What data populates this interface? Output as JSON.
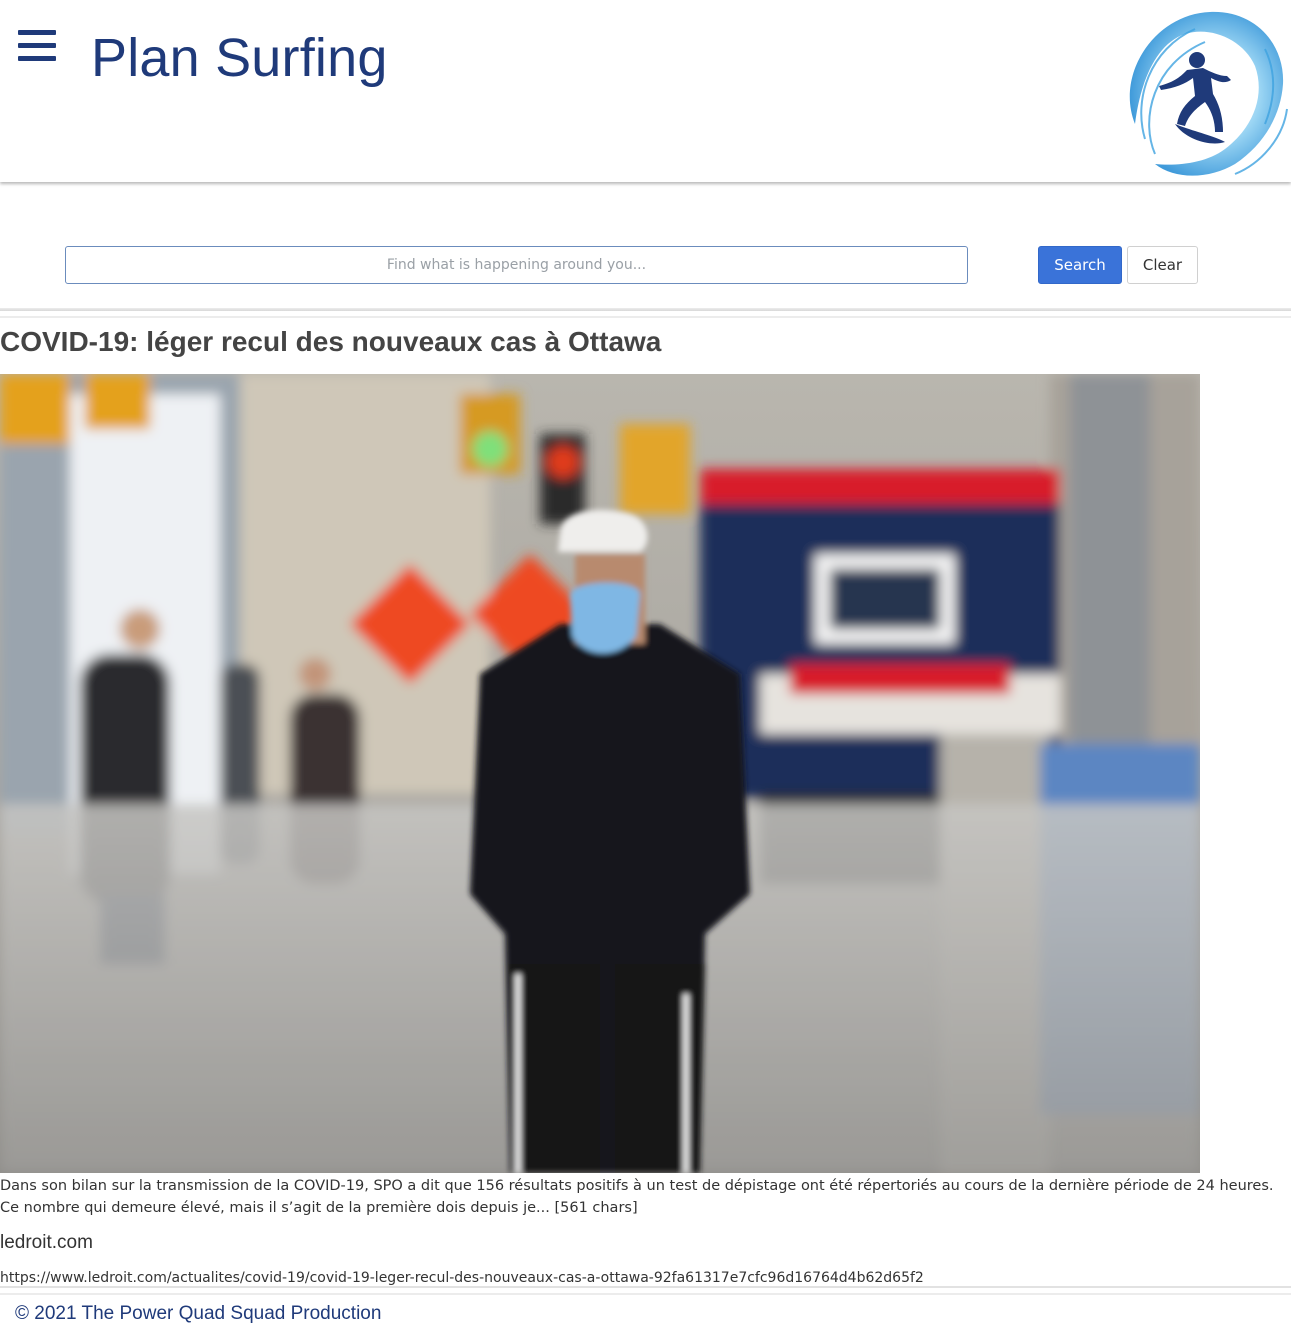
{
  "header": {
    "title": "Plan Surfing",
    "menu_icon": "hamburger-menu-icon",
    "logo": "surfer-wave-logo"
  },
  "search": {
    "placeholder": "Find what is happening around you...",
    "value": "",
    "search_label": "Search",
    "clear_label": "Clear"
  },
  "article": {
    "title": "COVID-19: léger recul des nouveaux cas à Ottawa",
    "image": "photo-masked-man-walking-ottawa-street",
    "description": "Dans son bilan sur la transmission de la COVID-19, SPO a dit que 156 résultats positifs à un test de dépistage ont été répertoriés au cours de la dernière période de 24 heures. Ce nombre qui demeure élevé, mais il s’agit de la première dois depuis je... [561 chars]",
    "source": "ledroit.com",
    "url": "https://www.ledroit.com/actualites/covid-19/covid-19-leger-recul-des-nouveaux-cas-a-ottawa-92fa61317e7cfc96d16764d4b62d65f2"
  },
  "footer": {
    "text": "© 2021 The Power Quad Squad Production"
  },
  "colors": {
    "brand": "#1f3a7a",
    "accent": "#3a73d9"
  }
}
